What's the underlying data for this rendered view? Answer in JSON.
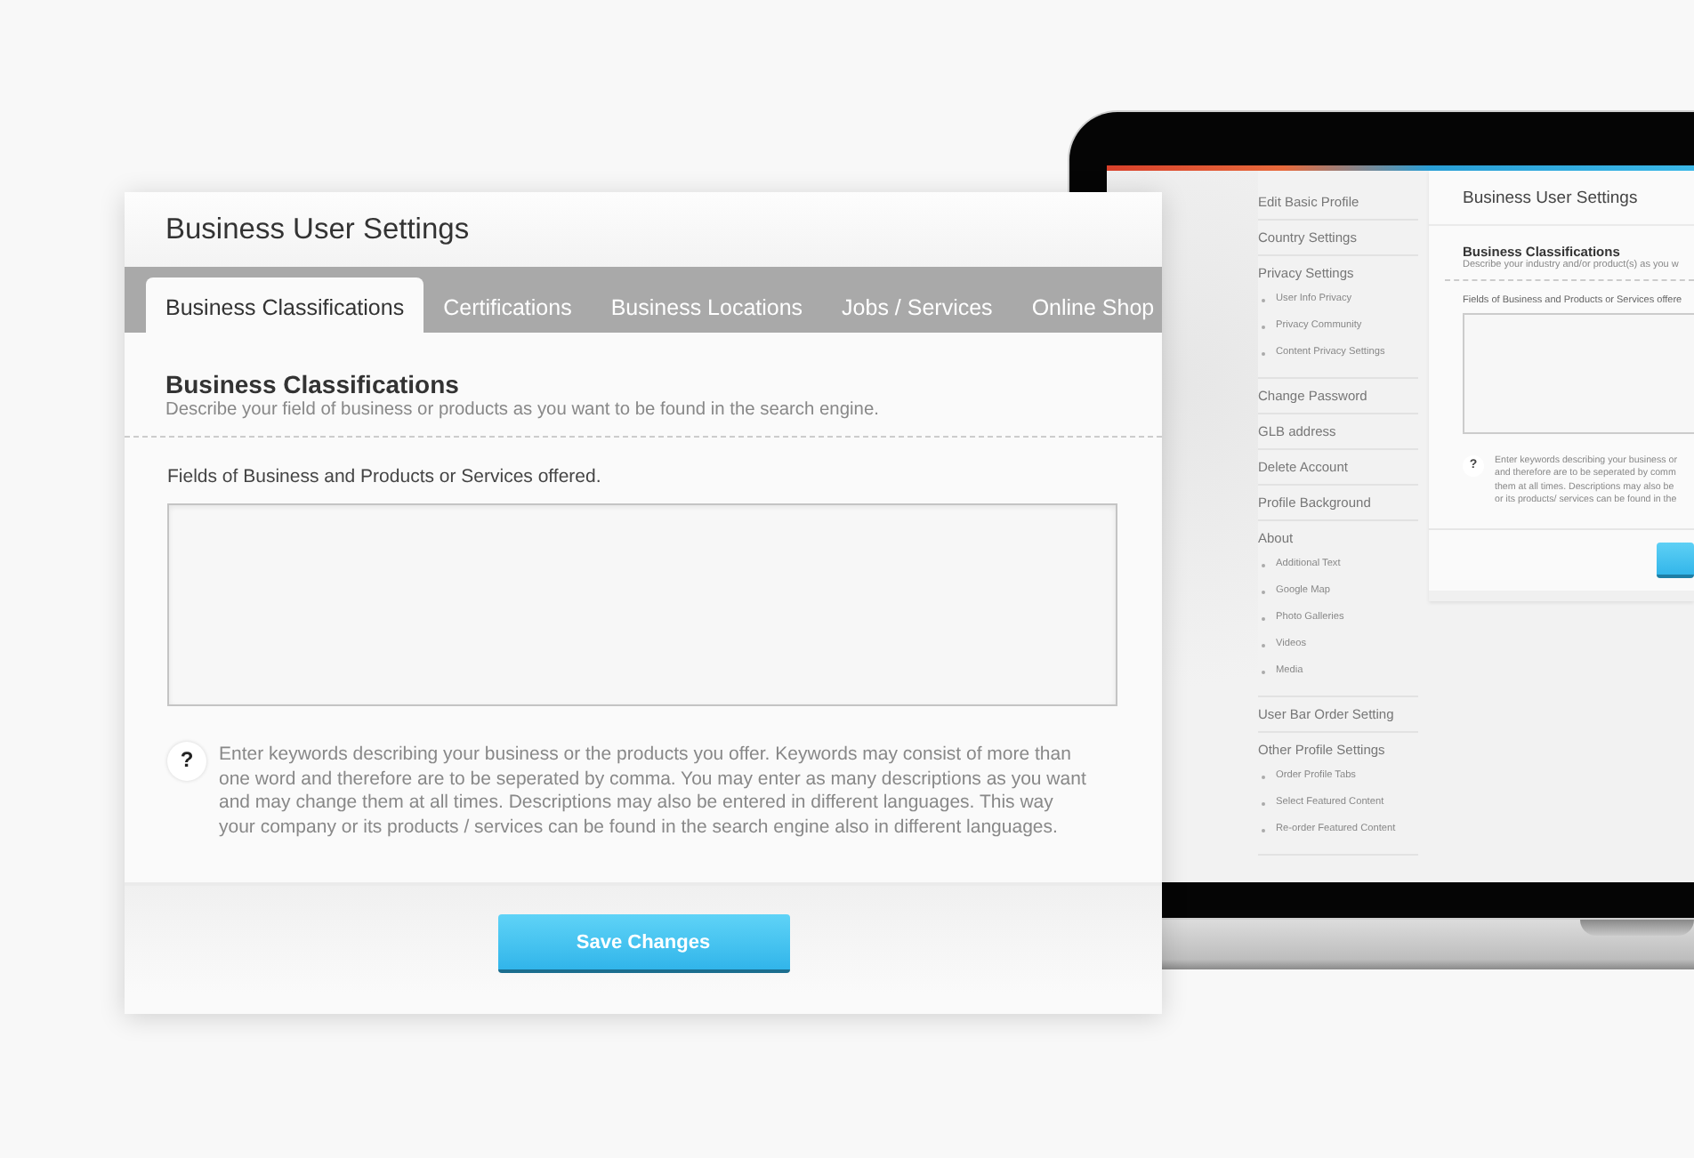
{
  "laptop_screen": {
    "sidebar": {
      "items": [
        {
          "label": "Edit Basic Profile"
        },
        {
          "label": "Country Settings"
        },
        {
          "label": "Privacy Settings",
          "children": [
            {
              "label": "User Info Privacy"
            },
            {
              "label": "Privacy Community"
            },
            {
              "label": "Content Privacy Settings"
            }
          ]
        },
        {
          "label": "Change Password"
        },
        {
          "label": "GLB address"
        },
        {
          "label": "Delete Account"
        },
        {
          "label": "Profile Background"
        },
        {
          "label": "About",
          "children": [
            {
              "label": "Additional Text"
            },
            {
              "label": "Google Map"
            },
            {
              "label": "Photo Galleries"
            },
            {
              "label": "Videos"
            },
            {
              "label": "Media"
            }
          ]
        },
        {
          "label": "User Bar Order Setting"
        },
        {
          "label": "Other Profile Settings",
          "children": [
            {
              "label": "Order Profile Tabs"
            },
            {
              "label": "Select Featured Content"
            },
            {
              "label": "Re-order Featured Content"
            }
          ]
        }
      ]
    },
    "panel": {
      "title": "Business User Settings",
      "heading": "Business Classifications",
      "description": "Describe your industry and/or product(s) as you w",
      "field_label": "Fields of Business and Products or Services offere",
      "help_icon": "?",
      "help_lines": [
        "Enter keywords describing your business or",
        "and therefore are to be seperated by comm",
        "them at all times. Descriptions may also be",
        "or its products/ services can be found in the"
      ]
    }
  },
  "settings_panel": {
    "title": "Business User Settings",
    "tabs": [
      {
        "label": "Business Classifications",
        "selected": true
      },
      {
        "label": "Certifications",
        "selected": false
      },
      {
        "label": "Business Locations",
        "selected": false
      },
      {
        "label": "Jobs / Services",
        "selected": false
      },
      {
        "label": "Online Shop",
        "selected": false
      }
    ],
    "heading": "Business Classifications",
    "description": "Describe your field of business or products as you want to be found in the search engine.",
    "field_label": "Fields of Business and Products or Services offered.",
    "help_icon": "?",
    "help_text": "Enter keywords describing your business or the products you offer. Keywords may consist of more than one word and therefore are to be seperated by comma. You may enter as many descriptions as you want and may change them at all times. Descriptions may also be entered in different languages. This way your company or its products / services can be found in the search engine also in different languages.",
    "button": "Save Changes"
  }
}
